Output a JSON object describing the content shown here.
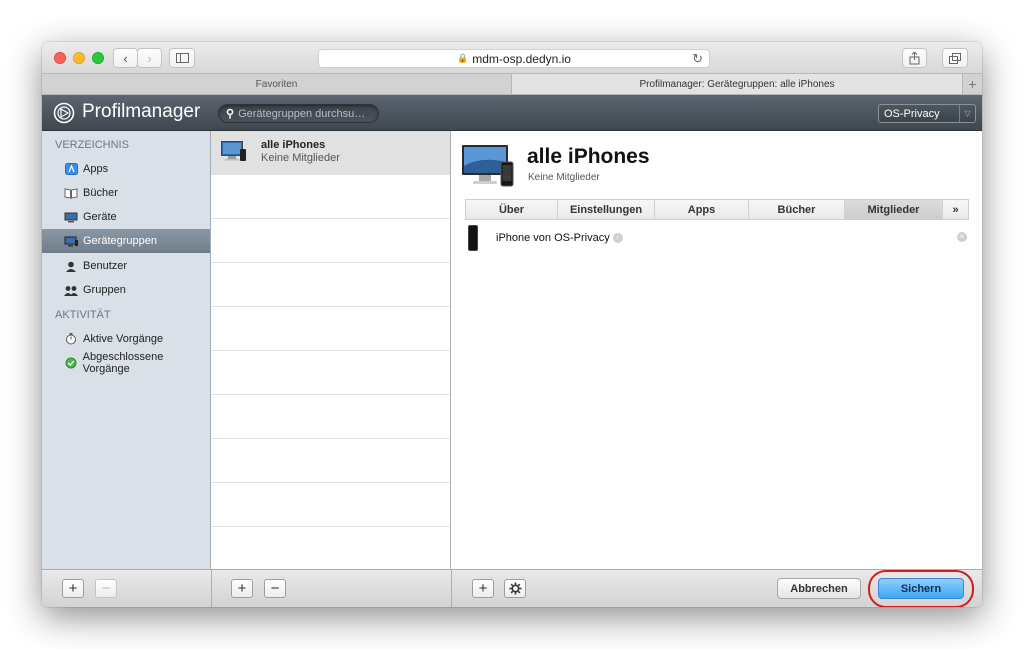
{
  "browser": {
    "url": "mdm-osp.dedyn.io",
    "tabs": [
      "Favoriten",
      "Profilmanager: Gerätegruppen: alle iPhones"
    ],
    "new_tab": "+"
  },
  "header": {
    "title": "Profilmanager",
    "search_placeholder": "Gerätegruppen durchsu…",
    "server": "OS-Privacy"
  },
  "sidebar": {
    "section1": "VERZEICHNIS",
    "section2": "AKTIVITÄT",
    "items": [
      {
        "label": "Apps",
        "icon": "apps-icon"
      },
      {
        "label": "Bücher",
        "icon": "book-icon"
      },
      {
        "label": "Geräte",
        "icon": "device-icon"
      },
      {
        "label": "Gerätegruppen",
        "icon": "device-group-icon",
        "selected": true
      },
      {
        "label": "Benutzer",
        "icon": "user-icon"
      },
      {
        "label": "Gruppen",
        "icon": "group-icon"
      }
    ],
    "activity": [
      {
        "label": "Aktive Vorgänge",
        "icon": "timer-icon"
      },
      {
        "label": "Abgeschlossene Vorgänge",
        "icon": "completed-icon"
      }
    ]
  },
  "list": {
    "items": [
      {
        "title": "alle iPhones",
        "subtitle": "Keine Mitglieder"
      }
    ]
  },
  "detail": {
    "title": "alle iPhones",
    "subtitle": "Keine Mitglieder",
    "tabs": [
      "Über",
      "Einstellungen",
      "Apps",
      "Bücher",
      "Mitglieder",
      "»"
    ],
    "selected_tab": "Mitglieder",
    "members": [
      {
        "name": "iPhone von OS-Privacy"
      }
    ]
  },
  "footer": {
    "cancel": "Abbrechen",
    "save": "Sichern"
  },
  "colors": {
    "header_bg": "#4a525a",
    "sidebar_bg": "#d9e0e8",
    "selected_sidebar": "#7b8896",
    "save_button": "#3ea6f2",
    "highlight": "#d41a1a"
  }
}
